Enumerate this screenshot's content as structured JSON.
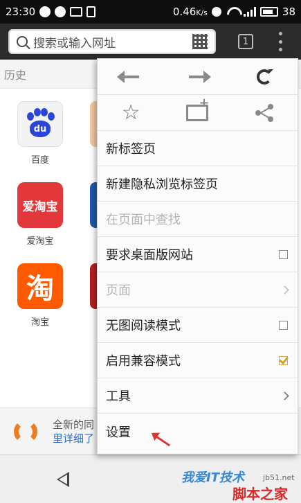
{
  "status_bar": {
    "time": "23:30",
    "data_rate": "0.46",
    "data_unit": "K/s",
    "battery": "38"
  },
  "browser": {
    "url_placeholder": "搜索或输入网址",
    "tab_count": "1"
  },
  "page": {
    "history_label": "历史",
    "tiles": [
      {
        "label": "百度",
        "icon_text": "du"
      },
      {
        "label": "爱淘宝",
        "icon_text": "爱淘宝"
      },
      {
        "label": "淘宝",
        "icon_text": "淘"
      }
    ],
    "banner": {
      "line1": "全新的同",
      "line2": "里详细了"
    }
  },
  "menu": {
    "items": [
      {
        "label": "新标签页",
        "enabled": true,
        "accessory": "none"
      },
      {
        "label": "新建隐私浏览标签页",
        "enabled": true,
        "accessory": "none"
      },
      {
        "label": "在页面中查找",
        "enabled": false,
        "accessory": "none"
      },
      {
        "label": "要求桌面版网站",
        "enabled": true,
        "accessory": "checkbox",
        "checked": false
      },
      {
        "label": "页面",
        "enabled": false,
        "accessory": "chevron"
      },
      {
        "label": "无图阅读模式",
        "enabled": true,
        "accessory": "checkbox",
        "checked": false
      },
      {
        "label": "启用兼容模式",
        "enabled": true,
        "accessory": "checkbox",
        "checked": true
      },
      {
        "label": "工具",
        "enabled": true,
        "accessory": "chevron"
      },
      {
        "label": "设置",
        "enabled": true,
        "accessory": "none"
      }
    ]
  },
  "watermark": {
    "line1": "我爱IT技术",
    "line2": "脚本之家",
    "site": "jb51.net"
  },
  "colors": {
    "accent_orange": "#f07c21",
    "link_blue": "#2a6dc9",
    "checkmark": "#e09c2a",
    "annotation_red": "#e0332e"
  }
}
